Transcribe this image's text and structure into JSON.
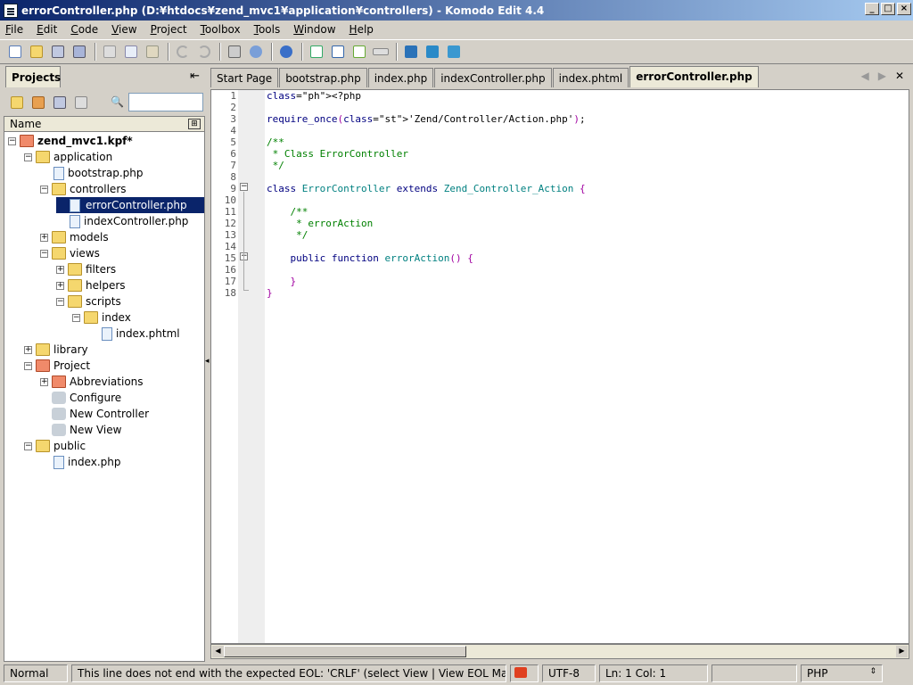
{
  "window": {
    "title": "errorController.php (D:¥htdocs¥zend_mvc1¥application¥controllers) - Komodo Edit 4.4"
  },
  "menu": [
    "File",
    "Edit",
    "Code",
    "View",
    "Project",
    "Toolbox",
    "Tools",
    "Window",
    "Help"
  ],
  "toolbar_icons": [
    "new-file-icon",
    "open-icon",
    "save-icon",
    "save-all-icon",
    "cut-icon",
    "copy-icon",
    "paste-icon",
    "undo-icon",
    "redo-icon",
    "print-icon",
    "help-icon",
    "browser-icon",
    "toggle-toolbox-icon",
    "toggle-projects-icon",
    "toggle-output-icon",
    "run-command-icon",
    "komodo-site-icon",
    "view-in-browser-icon",
    "debug-icon"
  ],
  "projects": {
    "tab_label": "Projects",
    "column_header": "Name",
    "search_placeholder": "",
    "tree": [
      {
        "label": "zend_mvc1.kpf*",
        "depth": 0,
        "type": "project",
        "bold": true
      },
      {
        "label": "application",
        "depth": 1,
        "type": "folder"
      },
      {
        "label": "bootstrap.php",
        "depth": 2,
        "type": "file"
      },
      {
        "label": "controllers",
        "depth": 2,
        "type": "folder"
      },
      {
        "label": "errorController.php",
        "depth": 3,
        "type": "file",
        "selected": true
      },
      {
        "label": "indexController.php",
        "depth": 3,
        "type": "file"
      },
      {
        "label": "models",
        "depth": 2,
        "type": "folder"
      },
      {
        "label": "views",
        "depth": 2,
        "type": "folder"
      },
      {
        "label": "filters",
        "depth": 3,
        "type": "folder"
      },
      {
        "label": "helpers",
        "depth": 3,
        "type": "folder"
      },
      {
        "label": "scripts",
        "depth": 3,
        "type": "folder"
      },
      {
        "label": "index",
        "depth": 4,
        "type": "folder"
      },
      {
        "label": "index.phtml",
        "depth": 5,
        "type": "file"
      },
      {
        "label": "library",
        "depth": 1,
        "type": "folder"
      },
      {
        "label": "Project",
        "depth": 1,
        "type": "folder-red"
      },
      {
        "label": "Abbreviations",
        "depth": 2,
        "type": "folder-red"
      },
      {
        "label": "Configure",
        "depth": 2,
        "type": "tool"
      },
      {
        "label": "New Controller",
        "depth": 2,
        "type": "tool"
      },
      {
        "label": "New View",
        "depth": 2,
        "type": "tool"
      },
      {
        "label": "public",
        "depth": 1,
        "type": "folder"
      },
      {
        "label": "index.php",
        "depth": 2,
        "type": "file"
      }
    ]
  },
  "editor": {
    "tabs": [
      "Start Page",
      "bootstrap.php",
      "index.php",
      "indexController.php",
      "index.phtml",
      "errorController.php"
    ],
    "active_tab": "errorController.php",
    "line_numbers": [
      "1",
      "2",
      "3",
      "4",
      "5",
      "6",
      "7",
      "8",
      "9",
      "10",
      "11",
      "12",
      "13",
      "14",
      "15",
      "16",
      "17",
      "18"
    ],
    "code_lines": [
      "<?php",
      "",
      "require_once('Zend/Controller/Action.php');",
      "",
      "/**",
      " * Class ErrorController",
      " */",
      "",
      "class ErrorController extends Zend_Controller_Action {",
      "",
      "    /**",
      "     * errorAction",
      "     */",
      "",
      "    public function errorAction() {",
      "",
      "    }",
      "}"
    ]
  },
  "statusbar": {
    "mode": "Normal",
    "message": "This line does not end with the expected EOL: 'CRLF' (select View | View EOL Markers)",
    "encoding": "UTF-8",
    "position": "Ln: 1 Col: 1",
    "language": "PHP"
  }
}
